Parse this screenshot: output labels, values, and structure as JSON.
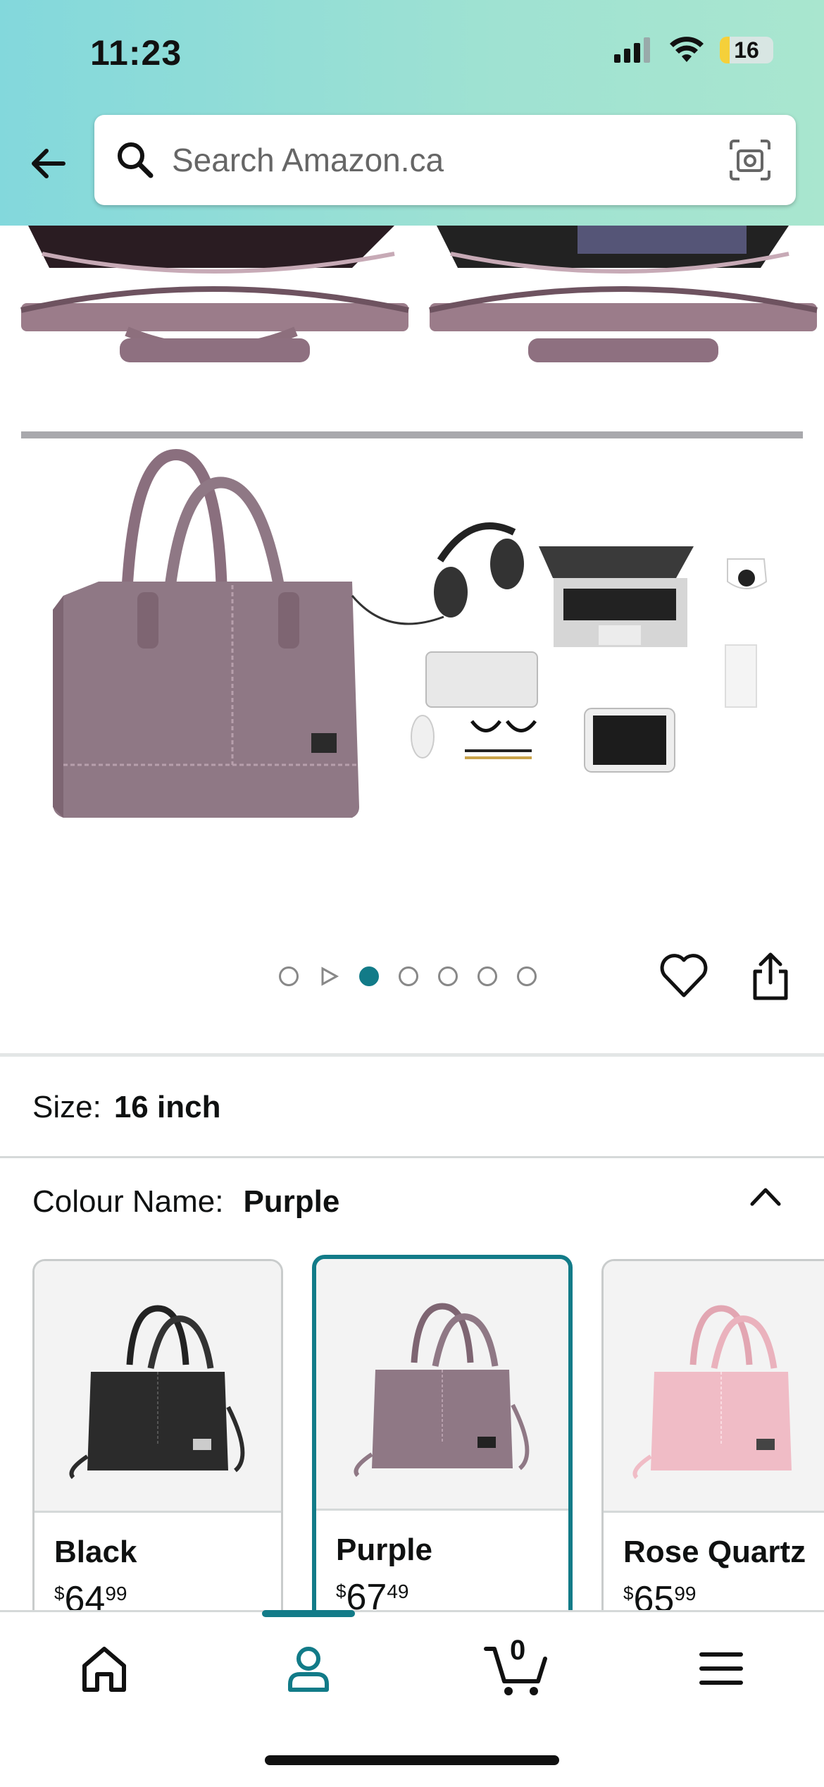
{
  "status_bar": {
    "time": "11:23",
    "battery": "16"
  },
  "search": {
    "placeholder": "Search Amazon.ca"
  },
  "carousel": {
    "dot_count": 7,
    "active_index": 2
  },
  "size": {
    "label": "Size:",
    "value": "16 inch"
  },
  "colour": {
    "label": "Colour Name:",
    "value": "Purple"
  },
  "swatches": [
    {
      "name": "Black",
      "currency": "$",
      "dollars": "64",
      "cents": "99",
      "color": "#2b2b2b"
    },
    {
      "name": "Purple",
      "currency": "$",
      "dollars": "67",
      "cents": "49",
      "color": "#8f7885",
      "selected": true
    },
    {
      "name": "Rose Quartz",
      "currency": "$",
      "dollars": "65",
      "cents": "99",
      "color": "#f0bcc6"
    }
  ],
  "bottom_nav": {
    "cart_count": "0",
    "items": [
      "home-icon",
      "account-icon",
      "cart-icon",
      "menu-icon"
    ]
  },
  "colors": {
    "accent": "#127b88",
    "bag_main": "#8f7885"
  }
}
